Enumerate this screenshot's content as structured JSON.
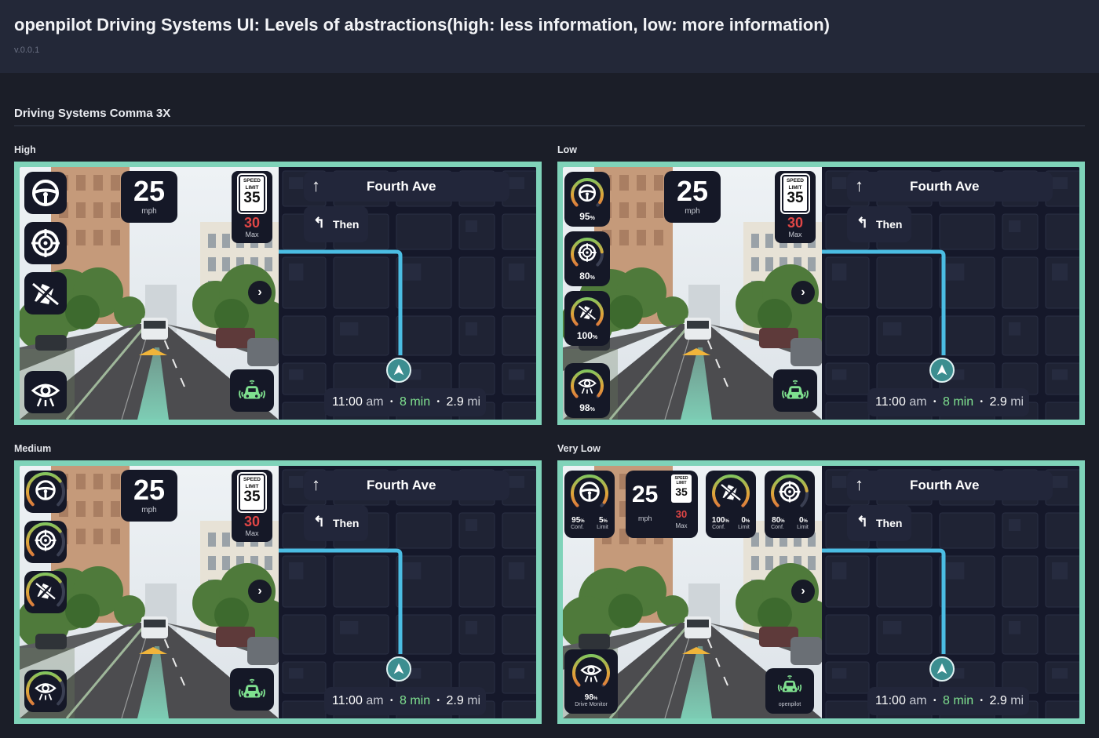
{
  "header": {
    "title": "openpilot Driving Systems UI: Levels of abstractions(high: less information, low: more information)",
    "version": "v.0.0.1"
  },
  "section": {
    "title": "Driving Systems Comma 3X"
  },
  "panels": {
    "high": {
      "label": "High"
    },
    "low": {
      "label": "Low",
      "steering_pct": "95",
      "target_pct": "80",
      "lane_pct": "100",
      "monitor_pct": "98"
    },
    "medium": {
      "label": "Medium"
    },
    "very_low": {
      "label": "Very Low",
      "steering": {
        "conf": "95",
        "limit": "5",
        "conf_label": "Conf.",
        "limit_label": "Limit"
      },
      "lane": {
        "conf": "100",
        "limit": "0",
        "conf_label": "Conf.",
        "limit_label": "Limit"
      },
      "target": {
        "conf": "80",
        "limit": "0",
        "conf_label": "Conf.",
        "limit_label": "Limit"
      },
      "monitor": {
        "pct": "98",
        "label": "Drive Monitor"
      },
      "openpilot_label": "openpilot"
    }
  },
  "hud": {
    "speed": "25",
    "speed_unit": "mph",
    "sign_line1": "SPEED",
    "sign_line2": "LIMIT",
    "sign_value": "35",
    "max_value": "30",
    "max_label": "Max",
    "percent_sign": "%"
  },
  "nav": {
    "street": "Fourth Ave",
    "then_label": "Then",
    "eta_time": "11:00",
    "eta_ampm": "am",
    "eta_duration": "8 min",
    "eta_distance_value": "2.9",
    "eta_distance_unit": "mi",
    "separator": "•"
  },
  "colors": {
    "accent_border": "#7fd3b9",
    "route_line": "#4bbde3",
    "max_speed": "#e04646",
    "eta_highlight": "#7fe08f"
  },
  "icons": [
    "steering-wheel-icon",
    "target-icon",
    "lane-departure-icon",
    "driver-monitor-icon",
    "openpilot-car-icon",
    "turn-straight-arrow-icon",
    "turn-left-arrow-icon",
    "chevron-right-icon",
    "navigation-arrow-icon"
  ]
}
